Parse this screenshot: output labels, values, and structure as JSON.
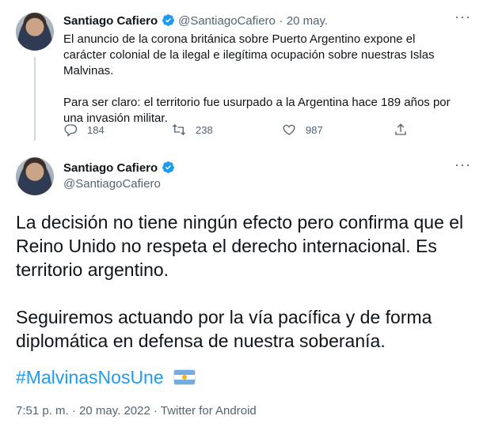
{
  "parent_tweet": {
    "author_name": "Santiago Cafiero",
    "handle": "@SantiagoCafiero",
    "separator": "·",
    "date": "20 may.",
    "paragraph1": "El anuncio de la corona británica sobre Puerto Argentino expone el carácter colonial de la ilegal e ilegítima ocupación sobre nuestras Islas Malvinas.",
    "paragraph2": "Para ser claro: el territorio fue usurpado a la Argentina hace 189 años por una invasión militar.",
    "replies": "184",
    "retweets": "238",
    "likes": "987",
    "more_glyph": "···"
  },
  "main_tweet": {
    "author_name": "Santiago Cafiero",
    "handle": "@SantiagoCafiero",
    "paragraph1": "La decisión no tiene ningún efecto pero confirma que el Reino Unido no respeta el derecho internacional. Es territorio argentino.",
    "paragraph2": "Seguiremos actuando por la vía pacífica y de forma diplomática en defensa de nuestra soberanía.",
    "hashtag": "#MalvinasNosUne",
    "timestamp": "7:51 p. m. · 20 may. 2022 · Twitter for Android",
    "more_glyph": "···"
  },
  "colors": {
    "accent": "#1d9bf0",
    "text": "#0f1419",
    "secondary": "#536471"
  },
  "icons": [
    "verified-badge-icon",
    "reply-icon",
    "retweet-icon",
    "like-icon",
    "share-icon",
    "more-icon",
    "argentina-flag-icon"
  ]
}
